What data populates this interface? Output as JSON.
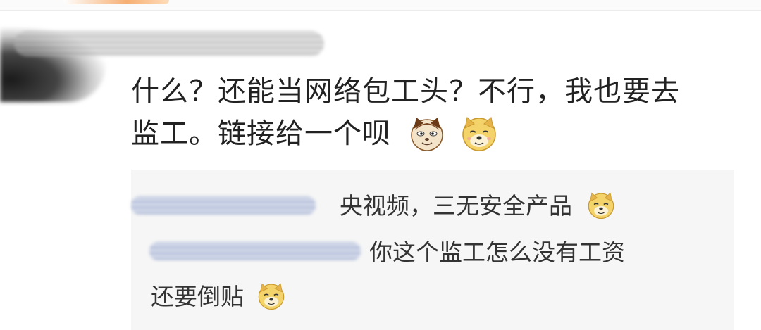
{
  "comment": {
    "text_line1": "什么？还能当网络包工头？不行，我也要去",
    "text_line2": "监工。链接给一个呗",
    "emojis": [
      "cat-face-icon",
      "doge-icon"
    ]
  },
  "replies": [
    {
      "text": "央视频，三无安全产品",
      "emoji": "doge-icon"
    },
    {
      "text_line1": "你这个监工怎么没有工资",
      "text_line2": "还要倒贴",
      "emoji": "doge-icon"
    }
  ],
  "colors": {
    "text": "#222222",
    "reply_text": "#333333",
    "reply_background": "#f6f6f6",
    "accent": "#f6a15a"
  }
}
